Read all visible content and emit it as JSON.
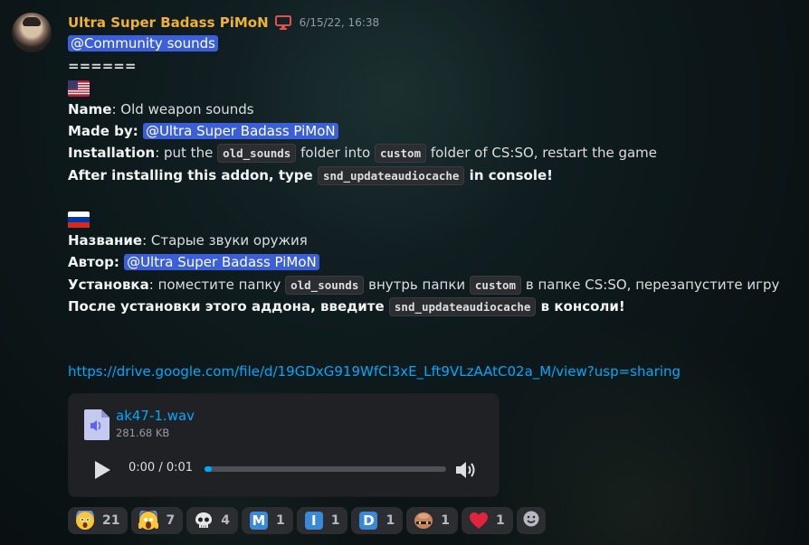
{
  "message": {
    "author": "Ultra Super Badass PiMoN",
    "timestamp": "6/15/22, 16:38",
    "role_icon": "monitor-icon",
    "author_color": "#f0b232"
  },
  "content": {
    "role_mention": "@Community sounds",
    "separator": "======",
    "en": {
      "flag": "us-flag-icon",
      "name_label": "Name",
      "name_value": ": Old weapon sounds",
      "made_by_label": "Made by",
      "made_by_sep": ": ",
      "made_by_mention": "@Ultra Super Badass PiMoN",
      "install_label": "Installation",
      "install_text1": ": put the ",
      "install_code1": "old_sounds",
      "install_text2": " folder into ",
      "install_code2": "custom",
      "install_text3": " folder of CS:SO, restart the game",
      "after_text1": "After installing this addon, type ",
      "after_code": "snd_updateaudiocache",
      "after_text2": " in console!"
    },
    "ru": {
      "flag": "ru-flag-icon",
      "name_label": "Название",
      "name_value": ": Старые звуки оружия",
      "made_by_label": "Автор",
      "made_by_sep": ": ",
      "made_by_mention": "@Ultra Super Badass PiMoN",
      "install_label": "Установка",
      "install_text1": ": поместите папку ",
      "install_code1": "old_sounds",
      "install_text2": " внутрь папки ",
      "install_code2": "custom",
      "install_text3": " в папке CS:SO, перезапустите игру",
      "after_text1": "После установки этого аддона, введите ",
      "after_code": "snd_updateaudiocache",
      "after_text2": " в консоли!"
    },
    "link": "https://drive.google.com/file/d/19GDxG919WfCl3xE_Lft9VLzAAtC02a_M/view?usp=sharing"
  },
  "attachment": {
    "file_name": "ak47-1.wav",
    "file_size": "281.68 KB",
    "time": "0:00 / 0:01",
    "progress": 0.03
  },
  "reactions": [
    {
      "icon": "fearful-face-icon",
      "count": "21"
    },
    {
      "icon": "screaming-face-icon",
      "count": "7"
    },
    {
      "icon": "skull-icon",
      "count": "4"
    },
    {
      "icon": "letter-m-icon",
      "letter": "M",
      "count": "1"
    },
    {
      "icon": "letter-i-icon",
      "letter": "I",
      "count": "1"
    },
    {
      "icon": "letter-d-icon",
      "letter": "D",
      "count": "1"
    },
    {
      "icon": "bald-head-icon",
      "count": "1"
    },
    {
      "icon": "heart-icon",
      "count": "1"
    }
  ]
}
